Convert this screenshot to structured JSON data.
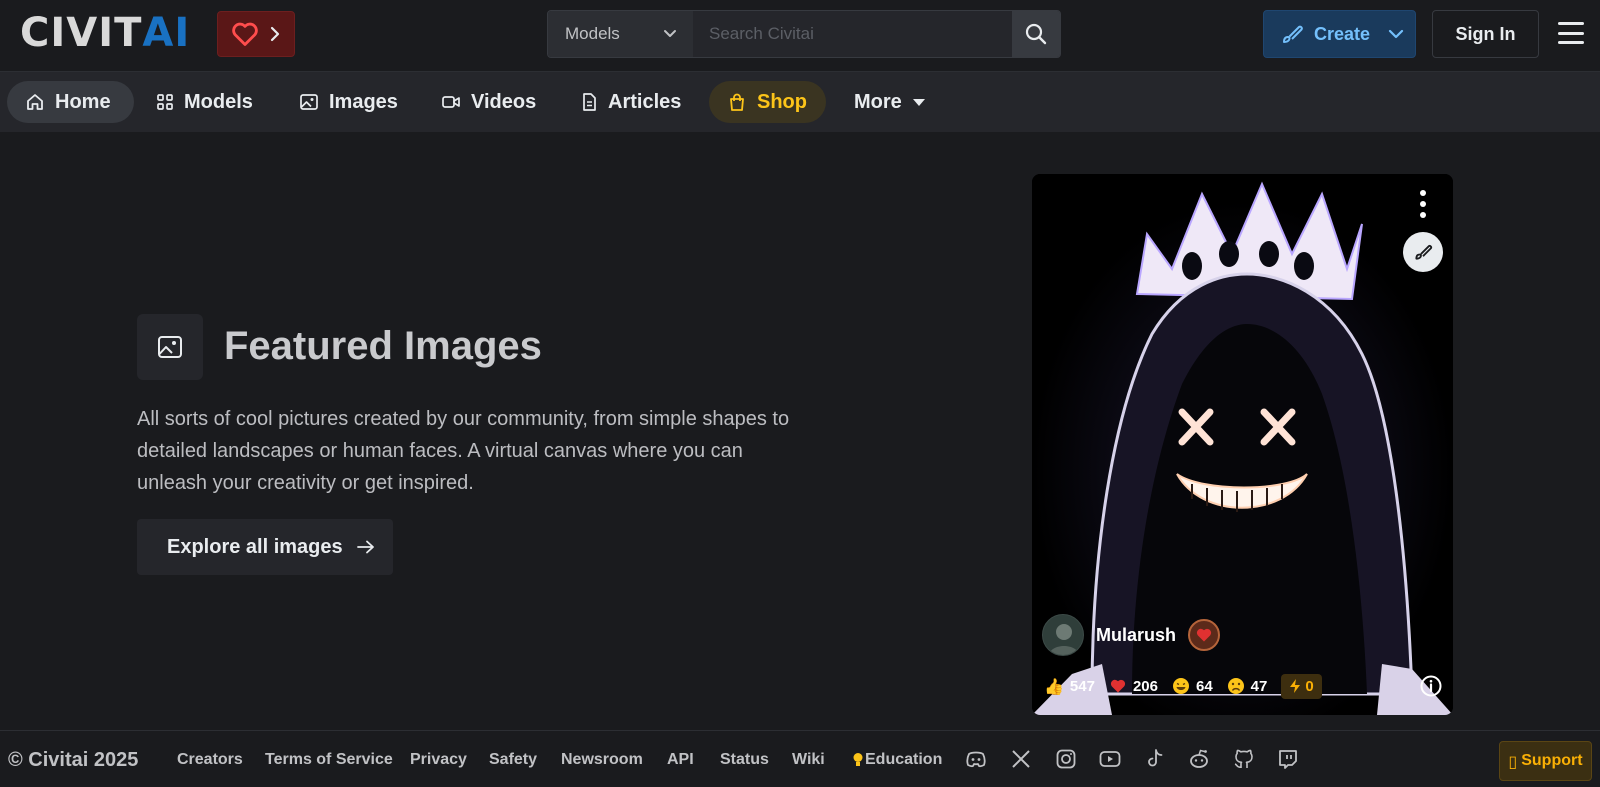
{
  "header": {
    "logo_left": "CIVIT",
    "logo_right": "AI",
    "search": {
      "category": "Models",
      "placeholder": "Search Civitai",
      "shortcut_key": "/"
    },
    "create_label": "Create",
    "signin_label": "Sign In"
  },
  "nav": {
    "items": [
      {
        "label": "Home",
        "icon": "home-icon"
      },
      {
        "label": "Models",
        "icon": "grid-icon"
      },
      {
        "label": "Images",
        "icon": "image-icon"
      },
      {
        "label": "Videos",
        "icon": "video-icon"
      },
      {
        "label": "Articles",
        "icon": "document-icon"
      },
      {
        "label": "Shop",
        "icon": "shopping-bag-icon"
      },
      {
        "label": "More",
        "icon": "caret-down-icon"
      }
    ]
  },
  "featured": {
    "title": "Featured Images",
    "description": "All sorts of cool pictures created by our community, from simple shapes to detailed landscapes or human faces. A virtual canvas where you can unleash your creativity or get inspired.",
    "cta_label": "Explore all images"
  },
  "card": {
    "username": "Mularush",
    "reactions": {
      "like": "547",
      "heart": "206",
      "laugh": "64",
      "cry": "47",
      "buzz": "0"
    }
  },
  "footer": {
    "copyright": "© Civitai 2025",
    "links": [
      "Creators",
      "Terms of Service",
      "Privacy",
      "Safety",
      "Newsroom",
      "API",
      "Status",
      "Wiki",
      "Education"
    ],
    "social": [
      "discord-icon",
      "x-icon",
      "instagram-icon",
      "youtube-icon",
      "tiktok-icon",
      "reddit-icon",
      "github-icon",
      "twitch-icon"
    ],
    "support_label": "Support"
  },
  "colors": {
    "background": "#1a1b1e",
    "nav_background": "#25262b",
    "brand_blue": "#1971c2",
    "shop_yellow": "#fcc419",
    "create_blue": "#74c0fc",
    "heart_red": "#e03131"
  }
}
